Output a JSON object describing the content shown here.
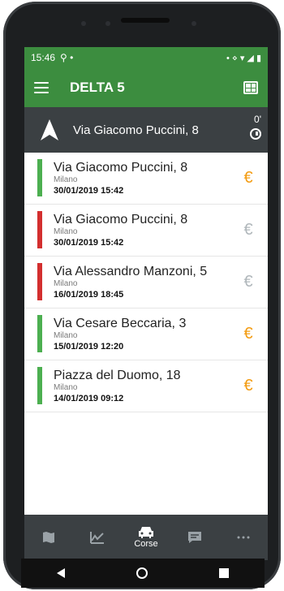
{
  "statusbar": {
    "time": "15:46",
    "left_icons": "⚲ •",
    "right_icons": "• ⋄ ▾ ◢ ▮"
  },
  "appbar": {
    "title": "DELTA 5"
  },
  "navigation": {
    "address": "Via Giacomo Puccini, 8",
    "eta": "0'"
  },
  "trips": [
    {
      "address": "Via Giacomo Puccini, 8",
      "city": "Milano",
      "datetime": "30/01/2019 15:42",
      "status_color": "#4caf50",
      "euro_color": "#f39c12"
    },
    {
      "address": "Via Giacomo Puccini, 8",
      "city": "Milano",
      "datetime": "30/01/2019 15:42",
      "status_color": "#d32f2f",
      "euro_color": "#b0b7bb"
    },
    {
      "address": "Via Alessandro Manzoni, 5",
      "city": "Milano",
      "datetime": "16/01/2019 18:45",
      "status_color": "#d32f2f",
      "euro_color": "#b0b7bb"
    },
    {
      "address": "Via Cesare Beccaria, 3",
      "city": "Milano",
      "datetime": "15/01/2019 12:20",
      "status_color": "#4caf50",
      "euro_color": "#f39c12"
    },
    {
      "address": "Piazza del Duomo, 18",
      "city": "Milano",
      "datetime": "14/01/2019 09:12",
      "status_color": "#4caf50",
      "euro_color": "#f39c12"
    }
  ],
  "euro_symbol": "€",
  "bottom_tabs": [
    {
      "icon": "map-icon",
      "label": ""
    },
    {
      "icon": "chart-icon",
      "label": ""
    },
    {
      "icon": "car-icon",
      "label": "Corse"
    },
    {
      "icon": "message-icon",
      "label": ""
    },
    {
      "icon": "more-icon",
      "label": ""
    }
  ],
  "colors": {
    "primary": "#3c8d3f",
    "dark": "#3b4043"
  }
}
